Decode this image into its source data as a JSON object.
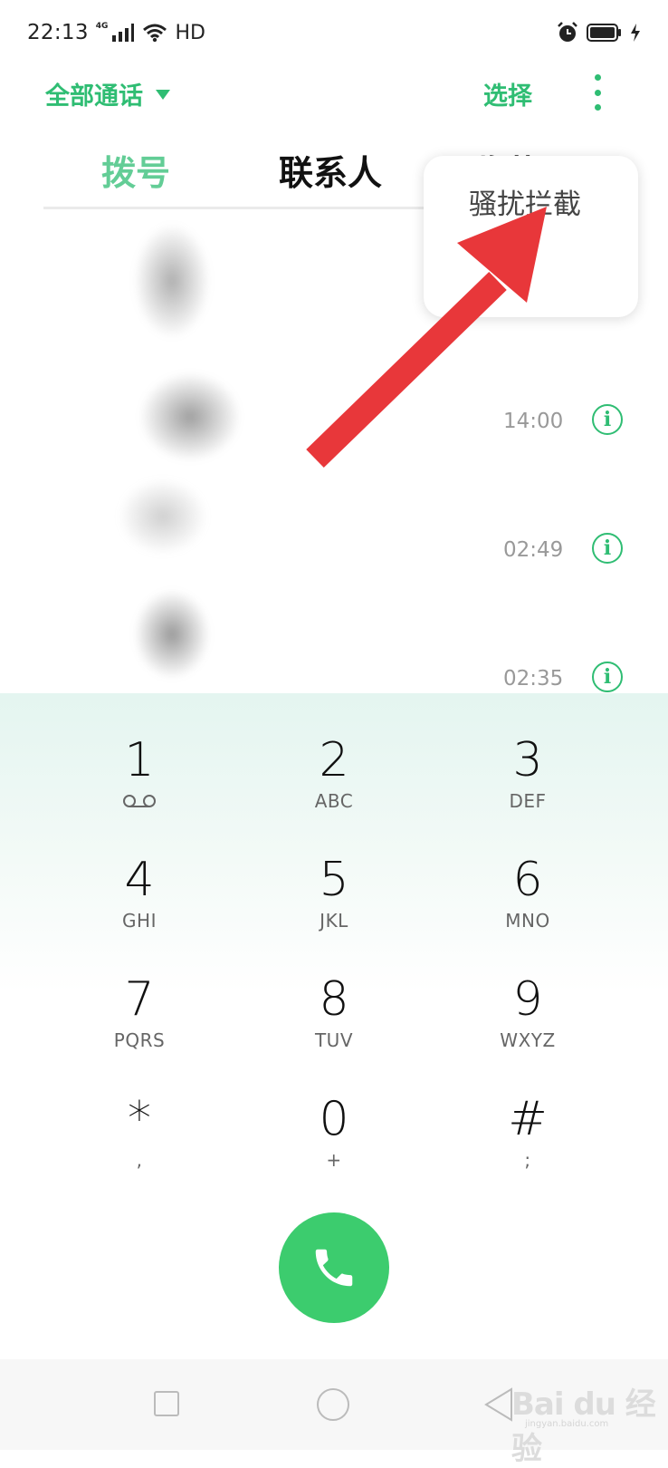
{
  "status_bar": {
    "time": "22:13",
    "network_type": "4G",
    "hd_label": "HD",
    "icons": [
      "signal-icon",
      "wifi-icon",
      "alarm-icon",
      "battery-icon",
      "charging-icon"
    ]
  },
  "header": {
    "filter_label": "全部通话",
    "select_label": "选择"
  },
  "tabs": [
    {
      "label": "拨号",
      "active": true
    },
    {
      "label": "联系人",
      "active": false
    },
    {
      "label": "收藏",
      "active": false
    }
  ],
  "popup_menu": {
    "items": [
      {
        "label": "骚扰拦截"
      }
    ]
  },
  "call_log": [
    {
      "time": "14:00"
    },
    {
      "time": "02:49"
    },
    {
      "time": "02:35"
    }
  ],
  "dialpad": {
    "keys": [
      {
        "digit": "1",
        "sub": ""
      },
      {
        "digit": "2",
        "sub": "ABC"
      },
      {
        "digit": "3",
        "sub": "DEF"
      },
      {
        "digit": "4",
        "sub": "GHI"
      },
      {
        "digit": "5",
        "sub": "JKL"
      },
      {
        "digit": "6",
        "sub": "MNO"
      },
      {
        "digit": "7",
        "sub": "PQRS"
      },
      {
        "digit": "8",
        "sub": "TUV"
      },
      {
        "digit": "9",
        "sub": "WXYZ"
      },
      {
        "digit": "*",
        "sub": ","
      },
      {
        "digit": "0",
        "sub": "+"
      },
      {
        "digit": "#",
        "sub": ";"
      }
    ]
  },
  "watermark": {
    "brand": "Bai du 经验",
    "url": "jingyan.baidu.com"
  },
  "colors": {
    "accent": "#2fbd73",
    "call_button": "#3ccc6e",
    "annotation_arrow": "#e8373a"
  }
}
